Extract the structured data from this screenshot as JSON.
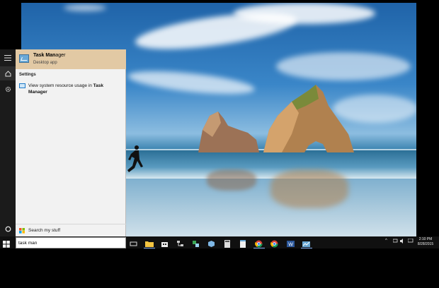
{
  "start_menu": {
    "best_match": {
      "title_prefix": "Task Man",
      "title_suffix": "ager",
      "subtitle": "Desktop app",
      "icon": "task-manager-icon"
    },
    "settings_header": "Settings",
    "settings_item": {
      "text_prefix": "View system resource usage in ",
      "text_bold": "Task Manager",
      "icon": "monitor-settings-icon"
    },
    "my_stuff_label": "Search my stuff",
    "search_query": "task man"
  },
  "rail": {
    "icons": [
      "hamburger-menu-icon",
      "home-icon",
      "settings-gear-icon",
      "cortana-circle-icon",
      "windows-start-icon"
    ]
  },
  "taskbar": {
    "pinned": [
      "task-view-icon",
      "file-explorer-icon",
      "store-icon",
      "network-icon",
      "app-green-icon",
      "3d-box-icon",
      "calculator-icon",
      "notepad-icon",
      "chrome-icon",
      "chrome-icon",
      "word-icon",
      "task-manager-icon"
    ],
    "tray_icons": [
      "chevron-up-icon",
      "network-tray-icon",
      "volume-icon",
      "language-icon"
    ],
    "clock_time": "2:10 PM",
    "clock_date": "8/28/2015"
  },
  "colors": {
    "taskbar_bg": "#101010",
    "best_match_highlight": "#e2c9a4",
    "panel_bg": "#f2f2f2",
    "accent": "#1e7ac8"
  }
}
